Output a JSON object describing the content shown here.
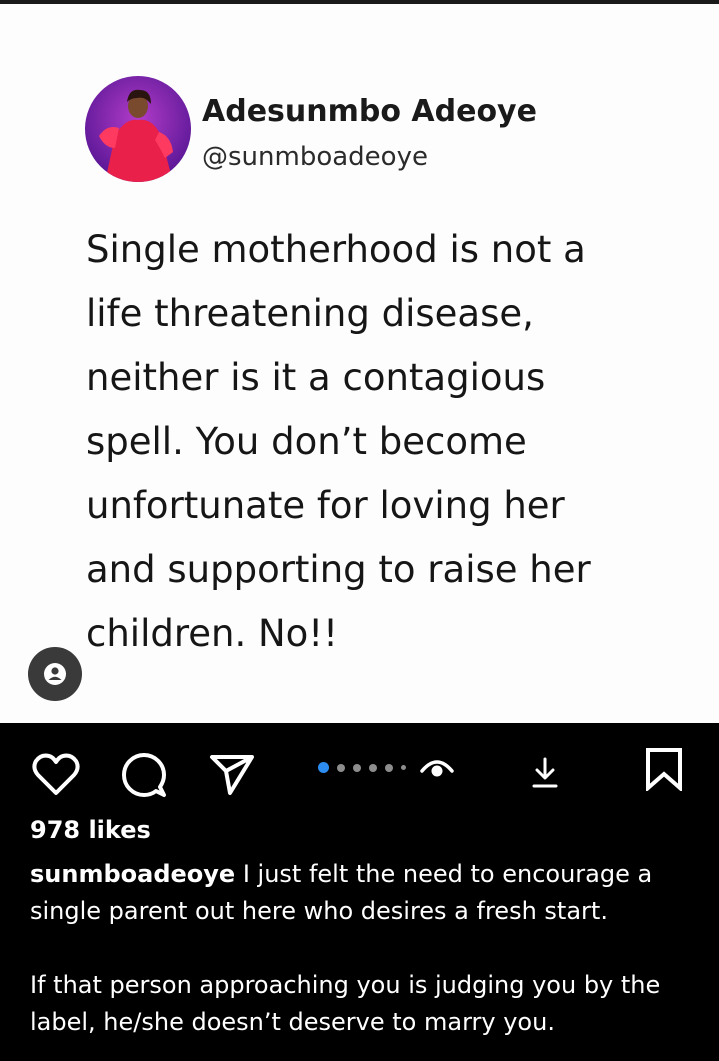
{
  "profile": {
    "name": "Adesunmbo Adeoye",
    "handle": "@sunmboadeoye"
  },
  "post": {
    "lines": [
      "Single motherhood is not a",
      "life threatening disease,",
      "neither is it a contagious",
      "spell. You don’t become",
      "unfortunate for loving her",
      "and supporting to raise her",
      "children. No!!"
    ]
  },
  "icons": {
    "like": "heart-icon",
    "comment": "comment-icon",
    "share": "send-icon",
    "views": "eye-icon",
    "download": "download-icon",
    "save": "bookmark-icon",
    "tag": "person-tag-icon"
  },
  "carousel": {
    "count": 6,
    "active_index": 0
  },
  "likes": "978 likes",
  "caption": {
    "username": "sunmboadeoye",
    "text_1": " I just felt the need to encourage a single parent out here who desires a fresh start.",
    "text_2": "If that person approaching you is judging you by the label, he/she doesn’t deserve to marry you."
  },
  "colors": {
    "accent": "#2d8cf0",
    "avatar_dress": "#e8204a",
    "avatar_bg": "#7a1fb5"
  }
}
